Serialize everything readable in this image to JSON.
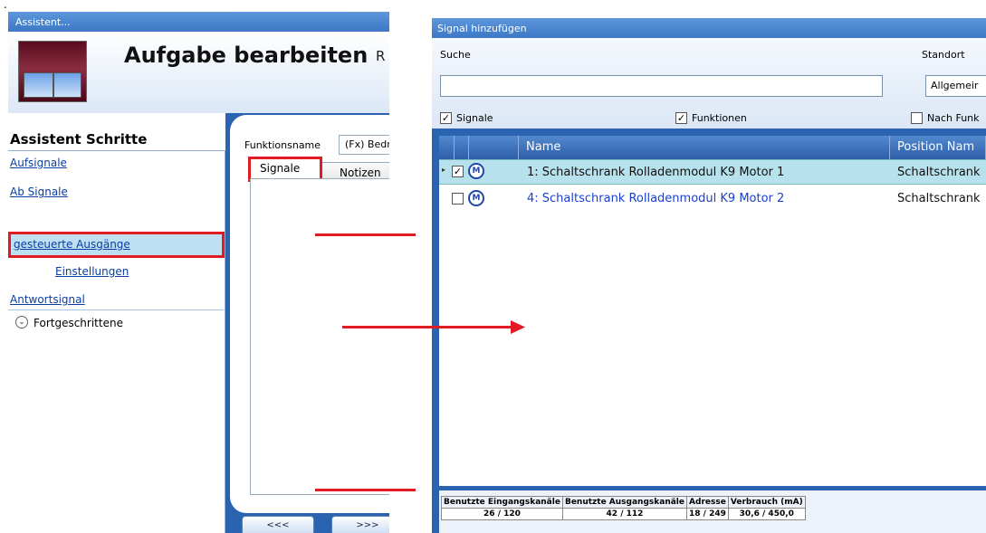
{
  "stray_mark": ".",
  "left_window": {
    "title": "Assistent...",
    "header_title": "Aufgabe bearbeiten",
    "header_extra": "R",
    "steps_heading": "Assistent Schritte",
    "steps": [
      {
        "label": "Aufsignale"
      },
      {
        "label": "Ab Signale"
      },
      {
        "label": "gesteuerte Ausgänge"
      },
      {
        "label": "Einstellungen"
      },
      {
        "label": "Antwortsignal"
      }
    ],
    "advanced_label": "Fortgeschrittene",
    "function_name_label": "Funktionsname",
    "function_name_value": "(Fx) Bedr",
    "tabs": [
      {
        "label": "Signale"
      },
      {
        "label": "Notizen"
      }
    ],
    "nav_back": "<<<",
    "nav_next": ">>>"
  },
  "right_window": {
    "title": "Signal hinzufügen",
    "search_label": "Suche",
    "search_value": "",
    "location_label": "Standort",
    "location_value": "Allgemeir",
    "checkboxes": [
      {
        "label": "Signale",
        "checked": true
      },
      {
        "label": "Funktionen",
        "checked": true
      },
      {
        "label": "Nach Funk",
        "checked": false
      }
    ],
    "columns": [
      "Name",
      "Position Nam"
    ],
    "rows": [
      {
        "name": "1: Schaltschrank Rolladenmodul K9 Motor 1",
        "position": "Schaltschrank",
        "checked": true,
        "icon": "M"
      },
      {
        "name": "4: Schaltschrank Rolladenmodul K9 Motor 2",
        "position": "Schaltschrank",
        "checked": false,
        "icon": "M"
      }
    ],
    "status": {
      "headers": [
        "Benutzte Eingangskanäle",
        "Benutzte Ausgangskanäle",
        "Adresse",
        "Verbrauch (mA)"
      ],
      "values": [
        "26 / 120",
        "42 / 112",
        "18 / 249",
        "30,6 / 450,0"
      ]
    }
  },
  "colors": {
    "highlight_red": "#e11b22",
    "window_blue": "#2a63b0",
    "selected_row": "#b7e1ec",
    "link_blue": "#0a3ea0"
  }
}
